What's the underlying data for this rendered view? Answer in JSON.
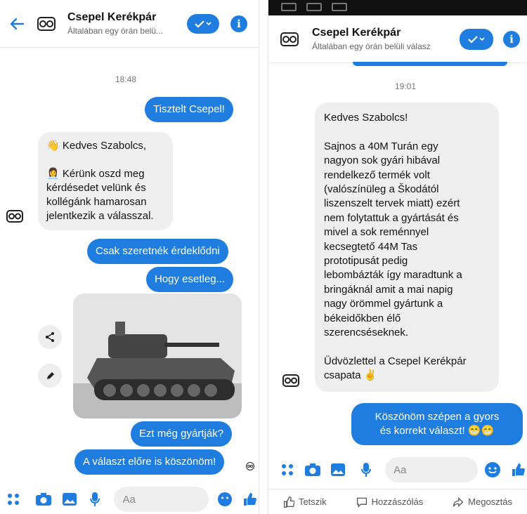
{
  "left": {
    "header": {
      "title": "Csepel Kerékpár",
      "subtitle": "Általában egy órán belü..."
    },
    "timestamp": "18:48",
    "messages": [
      {
        "dir": "out",
        "text": "Tisztelt Csepel!"
      },
      {
        "dir": "in",
        "text": "👋 Kedves Szabolcs,\n\n👩‍💼 Kérünk oszd meg\nkérdésedet velünk és\nkollégánk hamarosan\njelentkezik a válasszal."
      },
      {
        "dir": "out",
        "text": "Csak szeretnék érdeklődni"
      },
      {
        "dir": "out",
        "text": "Hogy esetleg..."
      },
      {
        "dir": "out",
        "text": "Ezt még gyártják?"
      },
      {
        "dir": "out",
        "text": "A választ előre is köszönöm!"
      }
    ],
    "composer_placeholder": "Aa"
  },
  "right": {
    "header": {
      "title": "Csepel Kerékpár",
      "subtitle": "Általában egy órán belüli válasz"
    },
    "timestamp": "19:01",
    "messages": [
      {
        "dir": "in",
        "text": "Kedves Szabolcs!\n\nSajnos a 40M Turán egy\nnagyon sok gyári hibával\nrendelkező termék volt\n(valószínüleg a Škodától\nliszenszelt tervek miatt) ezért\nnem folytattuk a gyártását és\nmivel a sok reménnyel\nkecsegtető 44M Tas\nprototipusát pedig\nlebombázták így maradtunk a\nbringáknál amit a mai napig\nnagy örömmel gyártunk a\nbékeidőkben élő\nszerencséseknek.\n\nÜdvözlettel a Csepel Kerékpár\ncsapata ✌️"
      },
      {
        "dir": "out",
        "text": "Köszönöm szépen a gyors\nés korrekt választ! 😁😁"
      }
    ],
    "composer_placeholder": "Aa",
    "fb_actions": [
      "Tetszik",
      "Hozzászólás",
      "Megosztás"
    ]
  },
  "colors": {
    "accent": "#1f7de0",
    "incoming": "#efefef"
  }
}
